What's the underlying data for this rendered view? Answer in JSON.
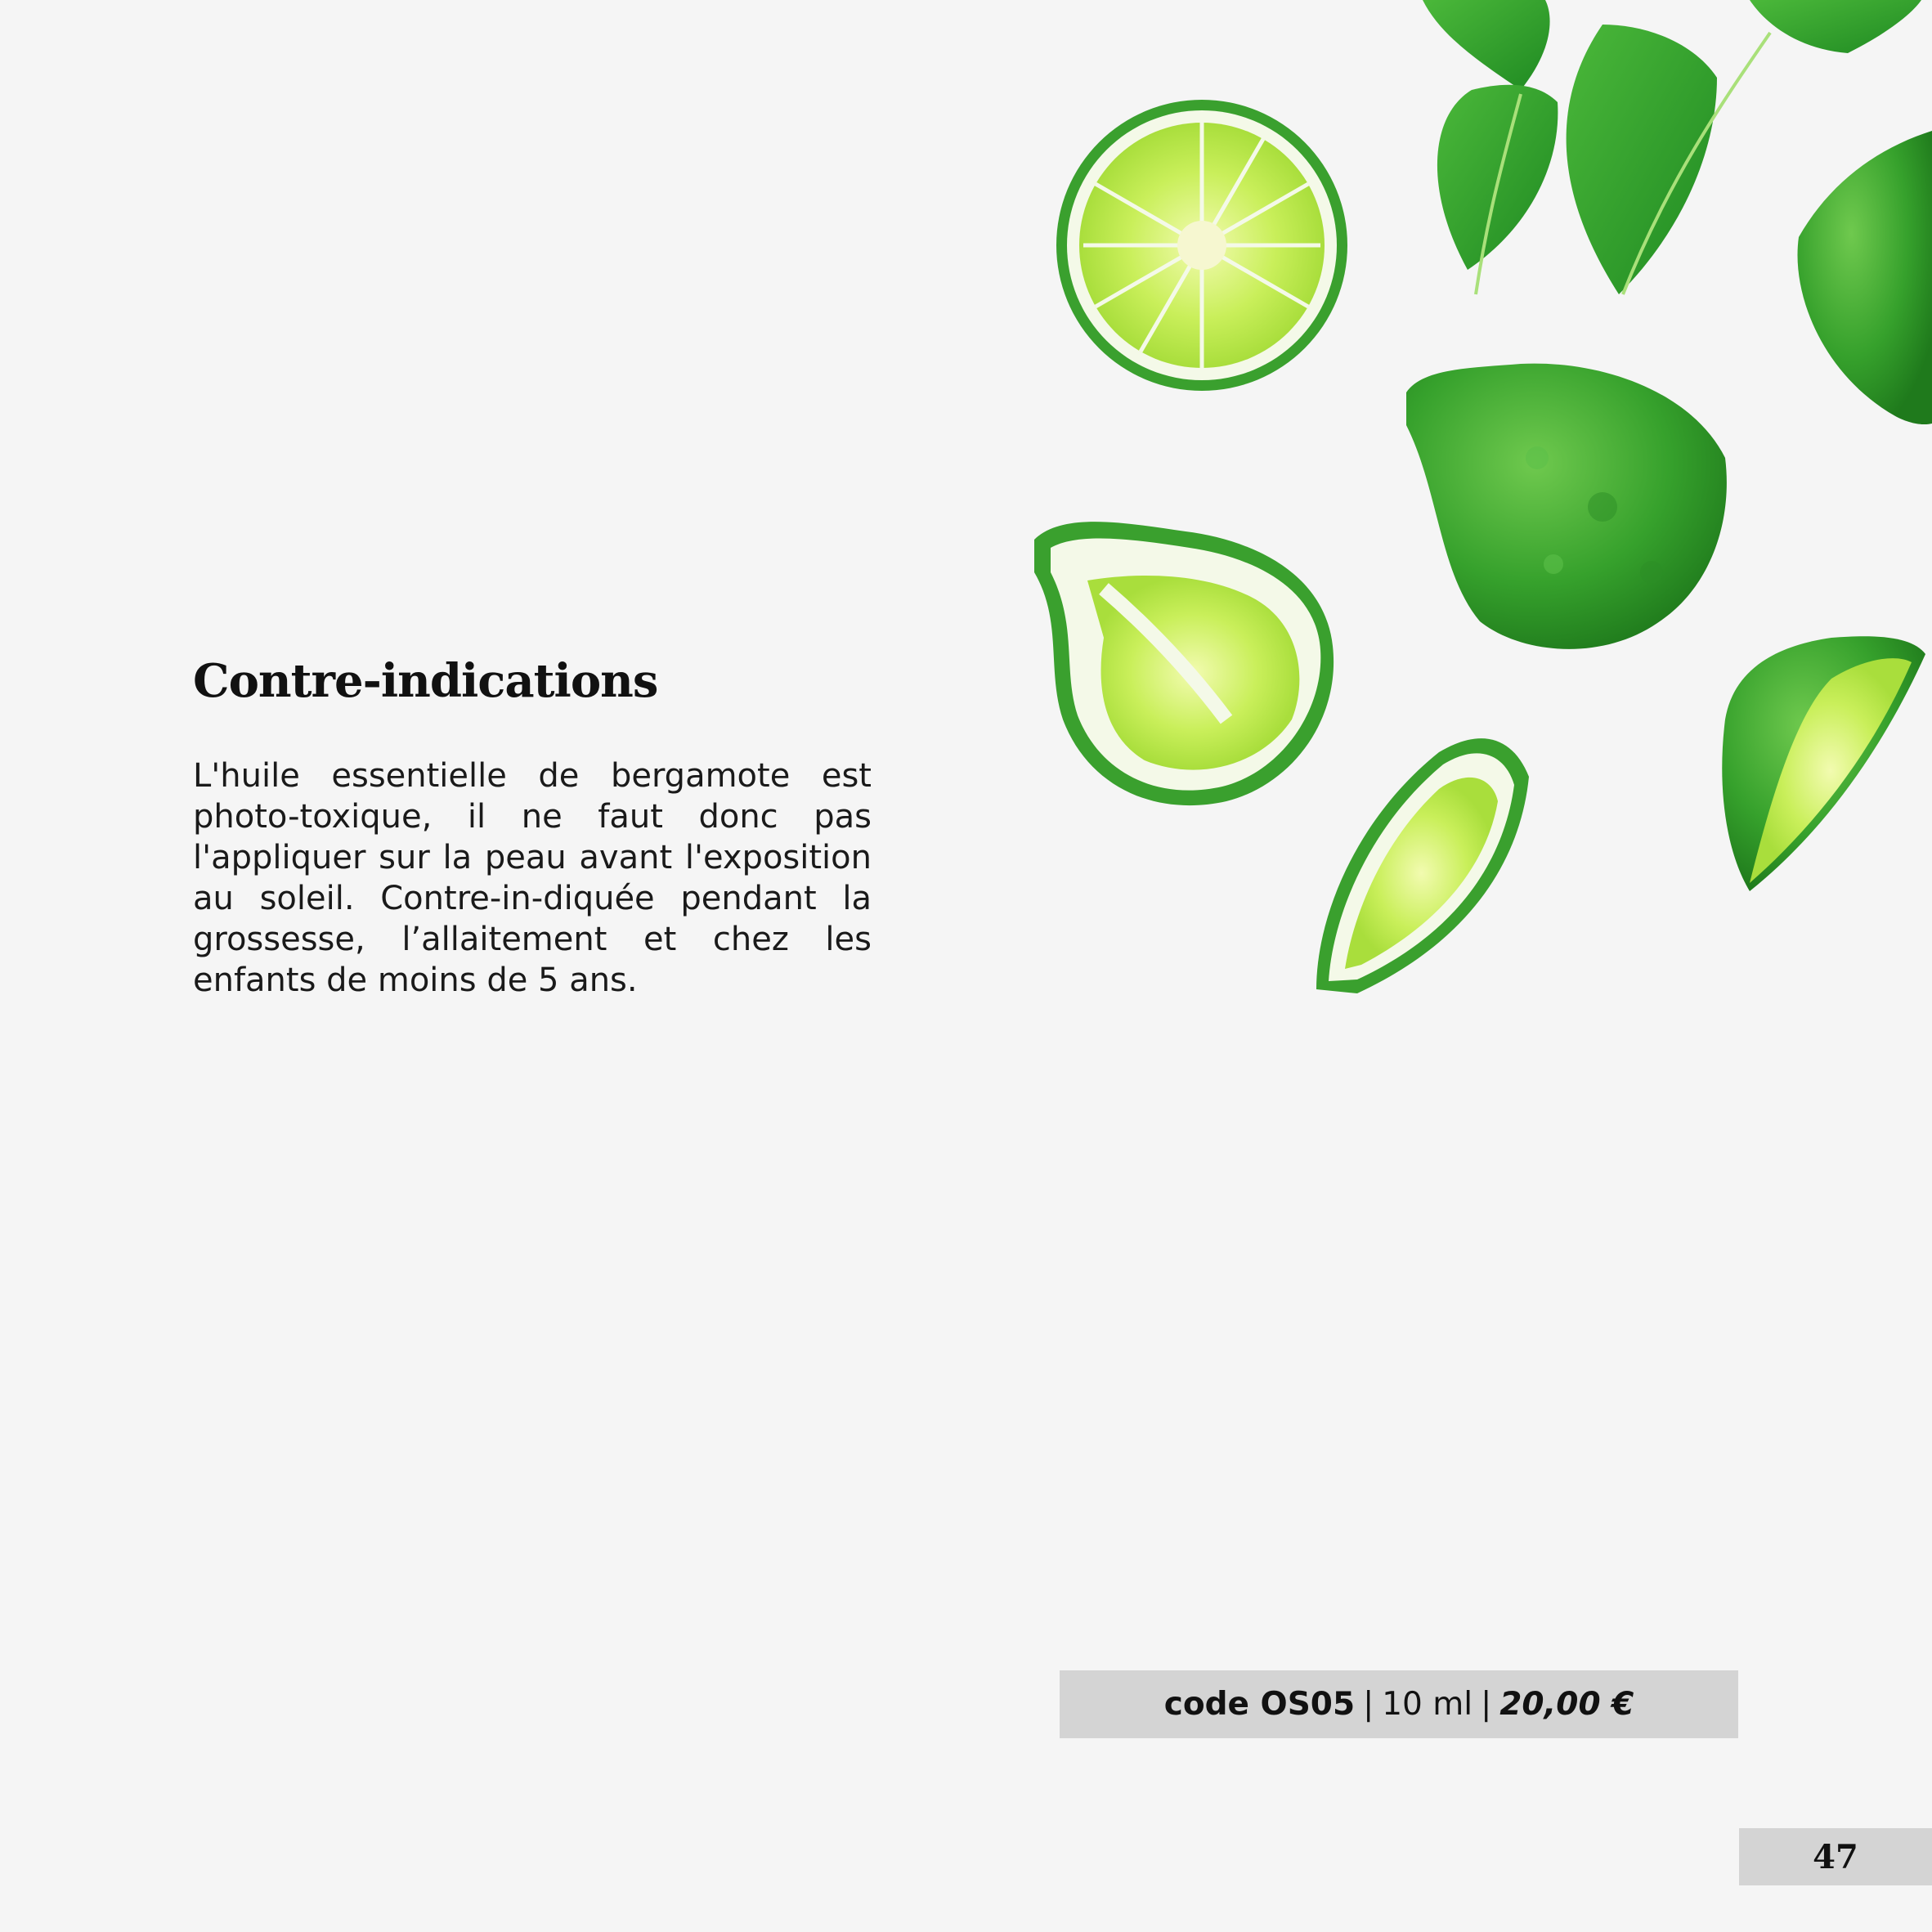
{
  "section": {
    "title": "Contre-indications",
    "body": "L'huile essentielle de bergamote est photo-toxique, il ne faut donc pas l'appliquer sur la peau avant l'exposition au soleil. Contre-in-diquée pendant la grossesse, l’allaitement et chez les enfants de moins de 5 ans."
  },
  "illustration": {
    "subject": "bergamot-fruits-and-leaves",
    "colors": {
      "leaf": "#2e9e2a",
      "leaf_vein": "#a9e07a",
      "rind": "#3aa02e",
      "flesh": "#c9ef5a",
      "pith": "#f4f9e8"
    }
  },
  "product": {
    "code_label": "code OS05",
    "separator": "|",
    "volume": "10 ml",
    "price": "20,00 €"
  },
  "page": {
    "number": "47"
  }
}
